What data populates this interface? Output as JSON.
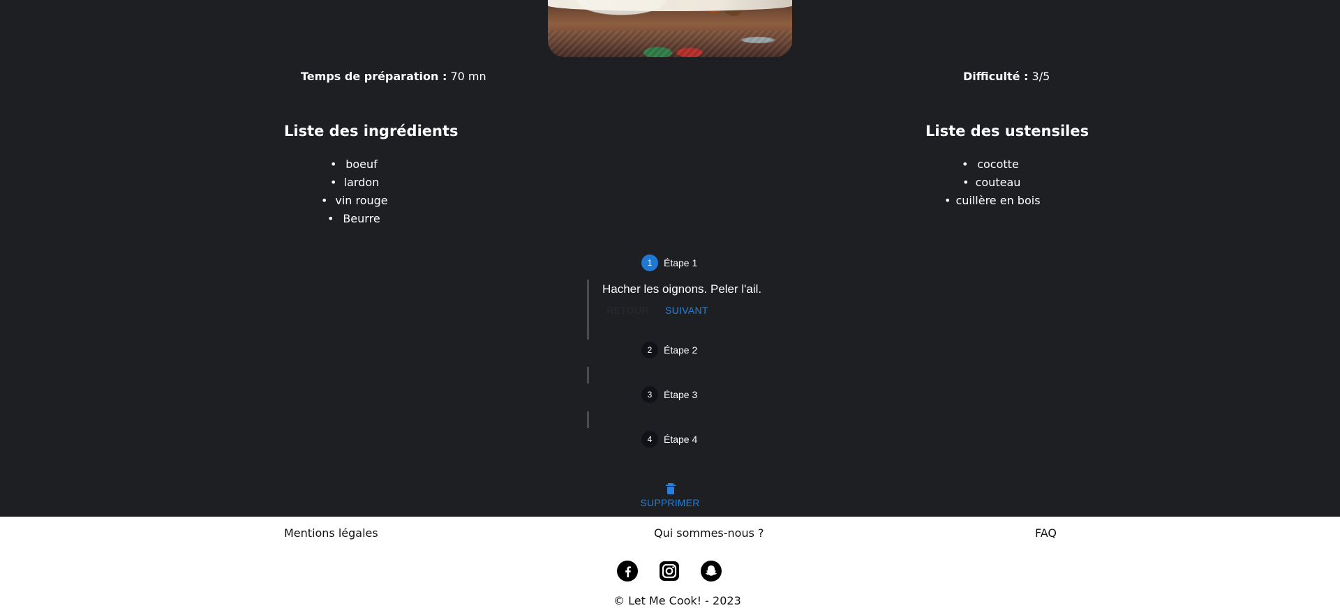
{
  "recipe": {
    "preparation_label": "Temps de préparation :",
    "preparation_value": "70 mn",
    "difficulty_label": "Difficulté :",
    "difficulty_value": "3/5"
  },
  "ingredients": {
    "title": "Liste des ingrédients",
    "items": [
      "boeuf",
      "lardon",
      "vin rouge",
      "Beurre"
    ]
  },
  "ustensiles": {
    "title": "Liste des ustensiles",
    "items": [
      "cocotte",
      "couteau",
      "cuillère en bois"
    ]
  },
  "steps": {
    "items": [
      {
        "number": "1",
        "label": "Étape 1",
        "active": true
      },
      {
        "number": "2",
        "label": "Étape 2",
        "active": false
      },
      {
        "number": "3",
        "label": "Étape 3",
        "active": false
      },
      {
        "number": "4",
        "label": "Étape 4",
        "active": false
      }
    ],
    "current_text": "Hacher les oignons. Peler l'ail.",
    "back_label": "RETOUR",
    "next_label": "SUIVANT"
  },
  "actions": {
    "delete_label": "SUPPRIMER"
  },
  "footer": {
    "legal": "Mentions légales",
    "about": "Qui sommes-nous ?",
    "faq": "FAQ",
    "copyright": "© Let Me Cook! - 2023"
  },
  "icons": {
    "trash": "trash-icon",
    "facebook": "facebook-icon",
    "instagram": "instagram-icon",
    "snapchat": "snapchat-icon"
  },
  "colors": {
    "background": "#1e1f23",
    "accent": "#1f78d1",
    "footer_background": "#ffffff"
  }
}
